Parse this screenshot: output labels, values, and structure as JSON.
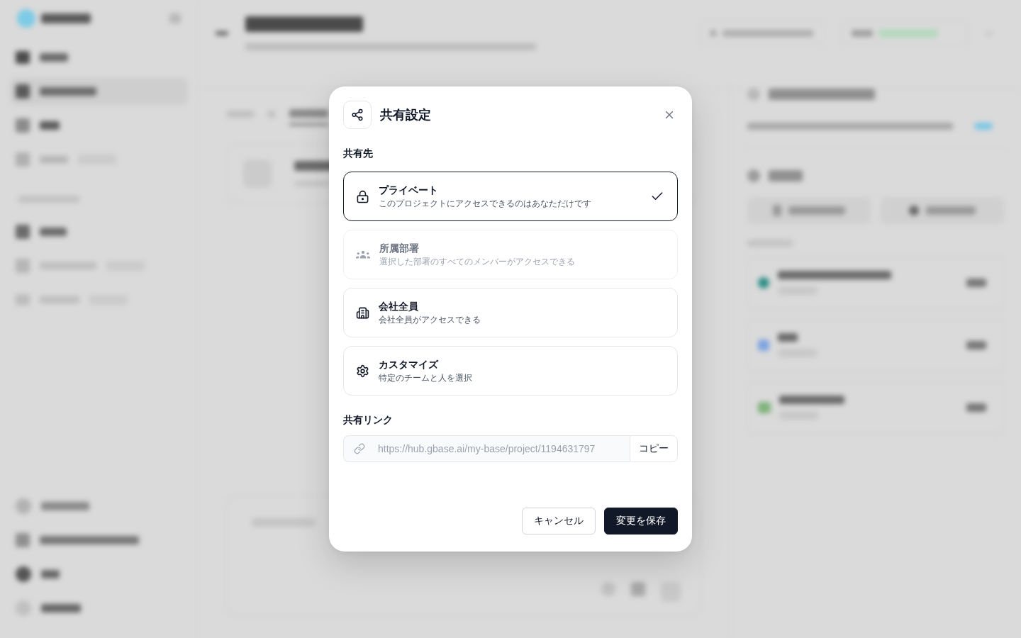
{
  "dialog": {
    "title": "共有設定",
    "audience_label": "共有先",
    "options": [
      {
        "kind": "private",
        "title": "プライベート",
        "description": "このプロジェクトにアクセスできるのはあなただけです",
        "selected": true,
        "disabled": false
      },
      {
        "kind": "department",
        "title": "所属部署",
        "description": "選択した部署のすべてのメンバーがアクセスできる",
        "selected": false,
        "disabled": true
      },
      {
        "kind": "company",
        "title": "会社全員",
        "description": "会社全員がアクセスできる",
        "selected": false,
        "disabled": false
      },
      {
        "kind": "custom",
        "title": "カスタマイズ",
        "description": "特定のチームと人を選択",
        "selected": false,
        "disabled": false
      }
    ],
    "link_label": "共有リンク",
    "link": {
      "value": "https://hub.gbase.ai/my-base/project/1194631797"
    },
    "copy_button": "コピー",
    "buttons": [
      {
        "kind": "secondary",
        "label": "キャンセル"
      },
      {
        "kind": "primary",
        "label": "変更を保存"
      }
    ]
  }
}
